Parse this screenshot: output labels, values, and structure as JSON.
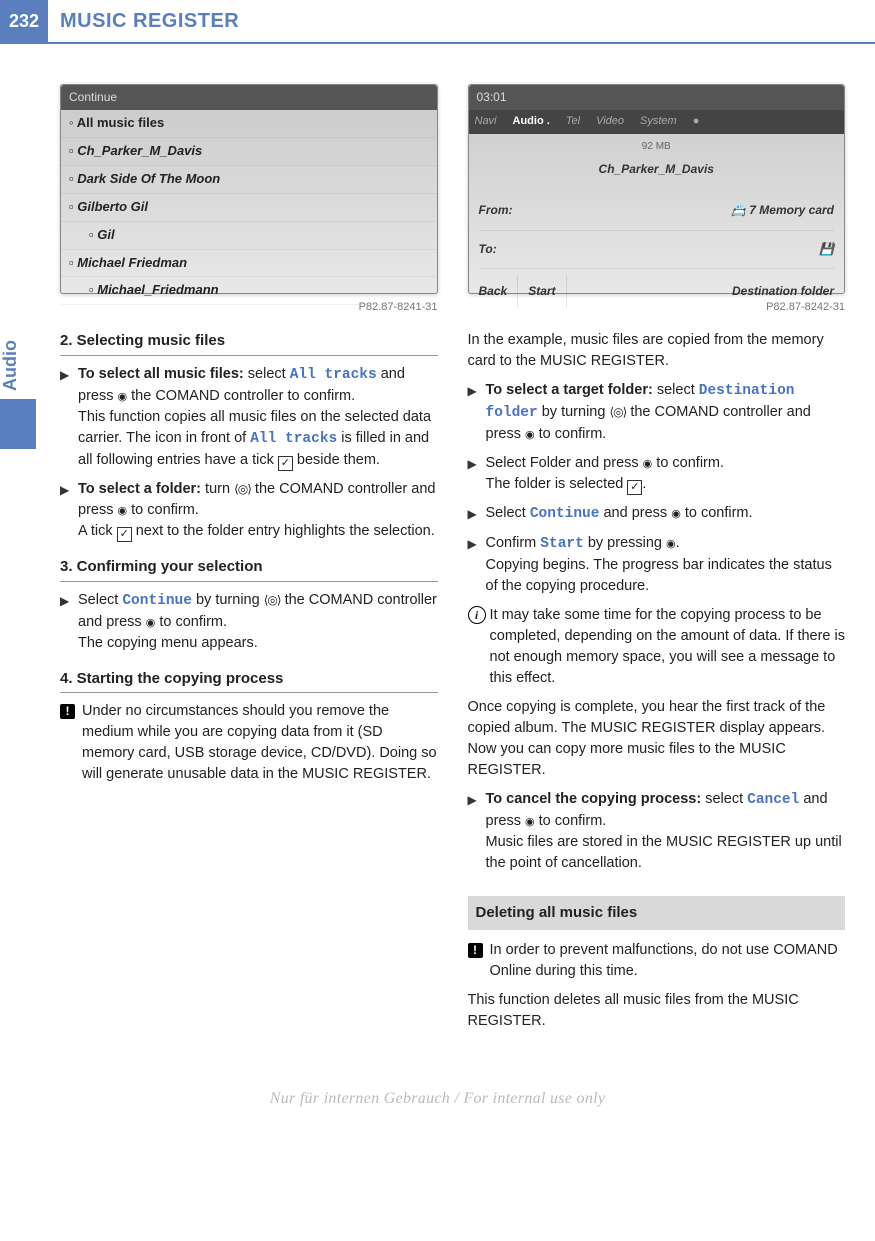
{
  "header": {
    "page_num": "232",
    "title": "MUSIC REGISTER"
  },
  "side_tab": "Audio",
  "screenshot1": {
    "header": "Continue",
    "items": [
      "All music files",
      "Ch_Parker_M_Davis",
      "Dark Side Of The Moon",
      "Gilberto Gil",
      "Gil",
      "Michael Friedman",
      "Michael_Friedmann"
    ],
    "caption": "P82.87-8241-31"
  },
  "screenshot2": {
    "time": "03:01",
    "tabs": [
      "Navi",
      "Audio .",
      "Tel",
      "Video",
      "System"
    ],
    "mb": "92 MB",
    "title": "Ch_Parker_M_Davis",
    "from_label": "From:",
    "from_val": "7 Memory card",
    "to_label": "To:",
    "footer": {
      "back": "Back",
      "start": "Start",
      "dest": "Destination folder"
    },
    "caption": "P82.87-8242-31"
  },
  "left": {
    "h2": "2. Selecting music files",
    "s1_lead": "To select all music files:",
    "s1_a": " select ",
    "s1_mono": "All tracks",
    "s1_b": " and press ",
    "s1_c": " the COMAND controller to confirm.",
    "s1_p2a": "This function copies all music files on the selected data carrier. The icon in front of ",
    "s1_p2b": " is filled in and all following entries have a tick ",
    "s1_p2c": " beside them.",
    "s2_lead": "To select a folder:",
    "s2_a": " turn ",
    "s2_b": " the COMAND controller and press ",
    "s2_c": " to confirm.",
    "s2_p2a": "A tick ",
    "s2_p2b": " next to the folder entry highlights the selection.",
    "h3": "3. Confirming your selection",
    "s3_a": "Select ",
    "s3_mono": "Continue",
    "s3_b": " by turning ",
    "s3_c": " the COMAND controller and press ",
    "s3_d": " to confirm.",
    "s3_p2": "The copying menu appears.",
    "h4": "4. Starting the copying process",
    "warn": "Under no circumstances should you remove the medium while you are copying data from it (SD memory card, USB storage device, CD/DVD). Doing so will generate unusable data in the MUSIC REGISTER."
  },
  "right": {
    "intro": "In the example, music files are copied from the memory card to the MUSIC REGISTER.",
    "r1_lead": "To select a target folder:",
    "r1_a": " select ",
    "r1_mono": "Destination folder",
    "r1_b": " by turning ",
    "r1_c": " the COMAND controller and press ",
    "r1_d": " to confirm.",
    "r2_a": "Select Folder and press ",
    "r2_b": " to confirm.",
    "r2_p2a": "The folder is selected ",
    "r2_p2b": ".",
    "r3_a": "Select ",
    "r3_mono": "Continue",
    "r3_b": " and press ",
    "r3_c": " to confirm.",
    "r4_a": "Confirm ",
    "r4_mono": "Start",
    "r4_b": " by pressing ",
    "r4_c": ".",
    "r4_p2": "Copying begins. The progress bar indicates the status of the copying procedure.",
    "info": "It may take some time for the copying process to be completed, depending on the amount of data. If there is not enough memory space, you will see a message to this effect.",
    "after": "Once copying is complete, you hear the first track of the copied album. The MUSIC REGISTER display appears. Now you can copy more music files to the MUSIC REGISTER.",
    "r5_lead": "To cancel the copying process:",
    "r5_a": " select ",
    "r5_mono": "Cancel",
    "r5_b": " and press ",
    "r5_c": " to confirm.",
    "r5_p2": "Music files are stored in the MUSIC REGISTER up until the point of cancellation.",
    "section": "Deleting all music files",
    "warn2": "In order to prevent malfunctions, do not use COMAND Online during this time.",
    "last": "This function deletes all music files from the MUSIC REGISTER."
  },
  "footer": "Nur für internen Gebrauch / For internal use only"
}
